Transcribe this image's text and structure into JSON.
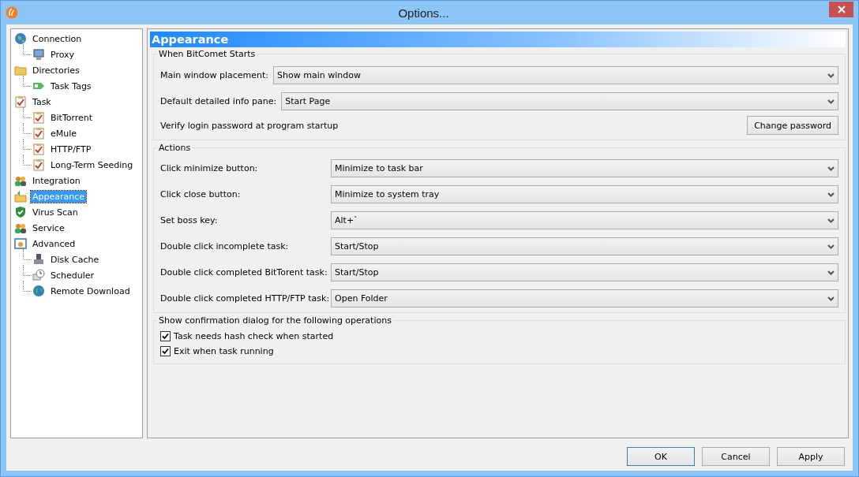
{
  "window": {
    "title": "Options..."
  },
  "tree": [
    {
      "label": "Connection",
      "selected": false,
      "children": [
        {
          "label": "Proxy",
          "selected": false
        }
      ]
    },
    {
      "label": "Directories",
      "selected": false,
      "children": [
        {
          "label": "Task Tags",
          "selected": false
        }
      ]
    },
    {
      "label": "Task",
      "selected": false,
      "children": [
        {
          "label": "BitTorrent",
          "selected": false
        },
        {
          "label": "eMule",
          "selected": false
        },
        {
          "label": "HTTP/FTP",
          "selected": false
        },
        {
          "label": "Long-Term Seeding",
          "selected": false
        }
      ]
    },
    {
      "label": "Integration",
      "selected": false
    },
    {
      "label": "Appearance",
      "selected": true
    },
    {
      "label": "Virus Scan",
      "selected": false
    },
    {
      "label": "Service",
      "selected": false
    },
    {
      "label": "Advanced",
      "selected": false,
      "children": [
        {
          "label": "Disk Cache",
          "selected": false
        },
        {
          "label": "Scheduler",
          "selected": false
        },
        {
          "label": "Remote Download",
          "selected": false
        }
      ]
    }
  ],
  "panel": {
    "title": "Appearance",
    "startup": {
      "title": "When BitComet Starts",
      "fields": [
        {
          "label": "Main window placement:",
          "value": "Show main window"
        },
        {
          "label": "Default detailed info pane:",
          "value": "Start Page"
        }
      ],
      "password_label": "Verify login password at program startup",
      "password_button": "Change password"
    },
    "actions": {
      "title": "Actions",
      "fields": [
        {
          "label": "Click minimize button:",
          "value": "Minimize to task bar"
        },
        {
          "label": "Click close button:",
          "value": "Minimize to system tray"
        },
        {
          "label": "Set boss key:",
          "value": "Alt+`"
        },
        {
          "label": "Double click incomplete task:",
          "value": "Start/Stop"
        },
        {
          "label": "Double click completed BitTorent task:",
          "value": "Start/Stop"
        },
        {
          "label": "Double click completed HTTP/FTP task:",
          "value": "Open Folder"
        }
      ]
    },
    "confirm": {
      "title": "Show confirmation dialog for the following operations",
      "options": [
        {
          "label": "Task needs hash check when started",
          "checked": true
        },
        {
          "label": "Exit when task running",
          "checked": true
        }
      ]
    }
  },
  "buttons": [
    {
      "label": "OK",
      "selected": true
    },
    {
      "label": "Cancel",
      "selected": false
    },
    {
      "label": "Apply",
      "selected": false
    }
  ]
}
